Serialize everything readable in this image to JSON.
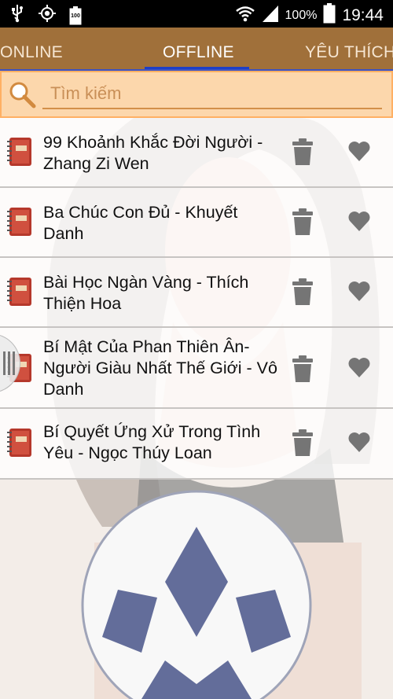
{
  "status_bar": {
    "battery_level": "100",
    "battery_percent": "100%",
    "time": "19:44",
    "icons": [
      "usb-icon",
      "gps-icon",
      "battery-small-icon",
      "wifi-icon",
      "signal-icon",
      "battery-icon"
    ]
  },
  "tabs": [
    {
      "label": "ONLINE",
      "active": false
    },
    {
      "label": "OFFLINE",
      "active": true
    },
    {
      "label": "YÊU THÍCH",
      "active": false
    }
  ],
  "search": {
    "placeholder": "Tìm kiếm",
    "value": ""
  },
  "books": [
    {
      "title": "99 Khoảnh Khắc Đời Người - Zhang Zi Wen"
    },
    {
      "title": "Ba Chúc Con Đủ - Khuyết Danh"
    },
    {
      "title": "Bài Học Ngàn Vàng - Thích Thiện Hoa"
    },
    {
      "title": "Bí Mật Của Phan Thiên Ân- Người Giàu Nhất Thế Giới - Vô Danh"
    },
    {
      "title": "Bí Quyết Ứng Xử Trong Tình Yêu - Ngọc Thúy Loan"
    }
  ],
  "colors": {
    "tab_bar": "#a0703a",
    "tab_indicator": "#1e3fc6",
    "search_bg": "#fcd7ac",
    "icon_gray": "#757575",
    "book_red": "#b5382b"
  }
}
